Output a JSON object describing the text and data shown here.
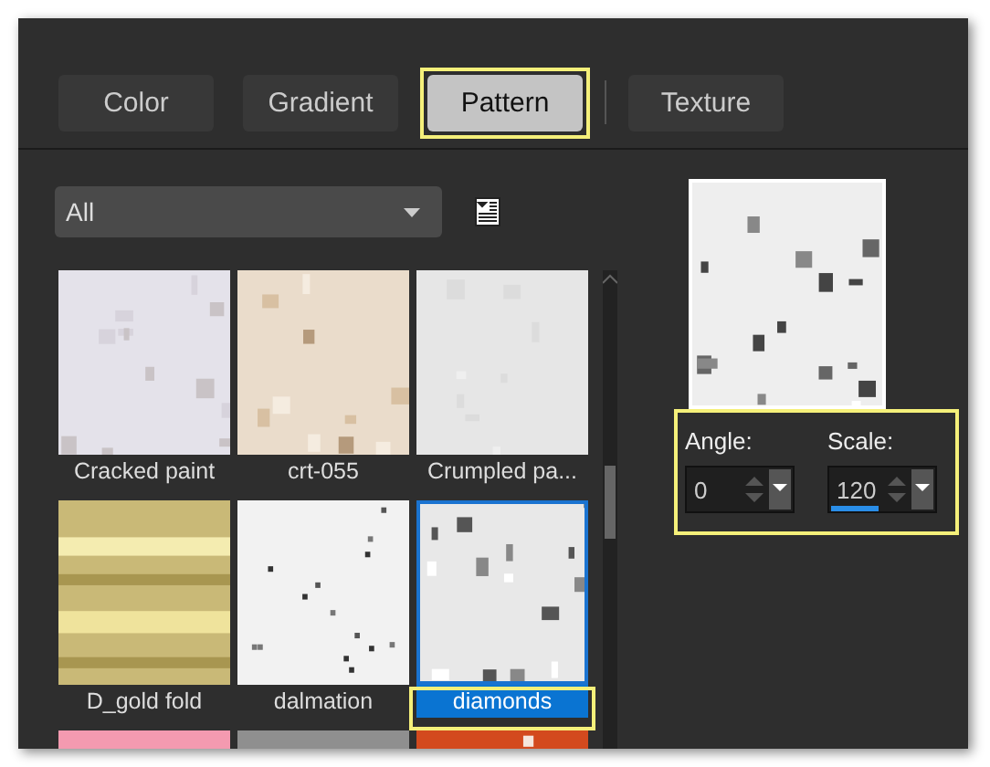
{
  "tabs": [
    {
      "label": "Color",
      "selected": false,
      "highlighted": false
    },
    {
      "label": "Gradient",
      "selected": false,
      "highlighted": false
    },
    {
      "label": "Pattern",
      "selected": true,
      "highlighted": true
    },
    {
      "label": "Texture",
      "selected": false,
      "highlighted": false
    }
  ],
  "category_dropdown": {
    "value": "All"
  },
  "patterns": [
    {
      "label": "Cracked paint",
      "selected": false,
      "highlighted": false
    },
    {
      "label": "crt-055",
      "selected": false,
      "highlighted": false
    },
    {
      "label": "Crumpled pa...",
      "selected": false,
      "highlighted": false
    },
    {
      "label": "D_gold fold",
      "selected": false,
      "highlighted": false
    },
    {
      "label": "dalmation",
      "selected": false,
      "highlighted": false
    },
    {
      "label": "diamonds",
      "selected": true,
      "highlighted": true
    },
    {
      "selected": false,
      "highlighted": false
    },
    {
      "selected": false,
      "highlighted": false
    },
    {
      "selected": false,
      "highlighted": false
    }
  ],
  "settings": {
    "highlighted": true,
    "angle": {
      "label": "Angle:",
      "value": "0"
    },
    "scale": {
      "label": "Scale:",
      "value": "120",
      "level": 0.45
    }
  }
}
